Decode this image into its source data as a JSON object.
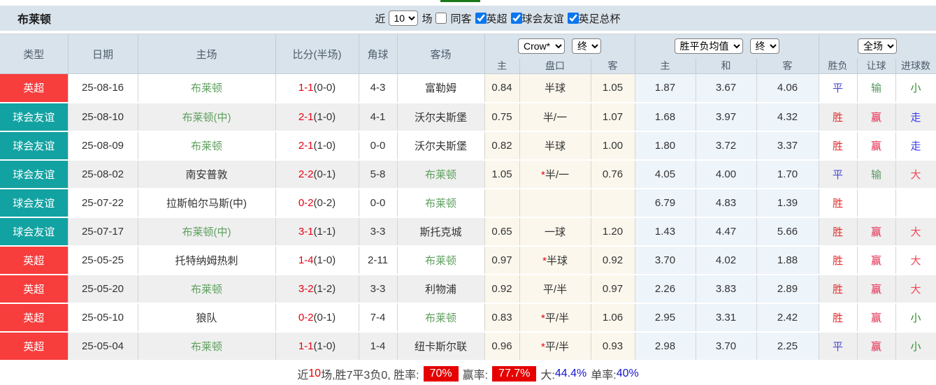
{
  "title": "布莱顿",
  "controls": {
    "near_label": "近",
    "games_count": "10",
    "games_label": "场",
    "same_away_label": "同客",
    "same_away_checked": false,
    "leagues": [
      {
        "label": "英超",
        "checked": true
      },
      {
        "label": "球会友谊",
        "checked": true
      },
      {
        "label": "英足总杯",
        "checked": true
      }
    ]
  },
  "header": {
    "cols": [
      "类型",
      "日期",
      "主场",
      "比分(半场)",
      "角球",
      "客场"
    ],
    "sub": [
      "主",
      "盘口",
      "客",
      "主",
      "和",
      "客",
      "胜负",
      "让球",
      "进球数"
    ],
    "selects": {
      "odds_source": "Crow*",
      "odds_time": "终",
      "avg_source": "胜平负均值",
      "avg_time": "终",
      "full_court": "全场"
    }
  },
  "rows": [
    {
      "league": "英超",
      "league_class": "lg-epl",
      "date": "25-08-16",
      "home": "布莱顿",
      "home_class": "team-self",
      "score": "1-1",
      "half": "(0-0)",
      "corner": "4-3",
      "away": "富勒姆",
      "away_class": "",
      "odds_home": "0.84",
      "line_star": "",
      "line": "半球",
      "odds_away": "1.05",
      "avg_home": "1.87",
      "avg_draw": "3.67",
      "avg_away": "4.06",
      "wdl": "平",
      "wdl_class": "c-draw",
      "handicap": "输",
      "handicap_class": "c-lose",
      "goals": "小",
      "goals_class": "c-small"
    },
    {
      "league": "球会友谊",
      "league_class": "lg-friendly",
      "date": "25-08-10",
      "home": "布莱顿(中)",
      "home_class": "team-self",
      "score": "2-1",
      "half": "(1-0)",
      "corner": "4-1",
      "away": "沃尔夫斯堡",
      "away_class": "",
      "odds_home": "0.75",
      "line_star": "",
      "line": "半/一",
      "odds_away": "1.07",
      "avg_home": "1.68",
      "avg_draw": "3.97",
      "avg_away": "4.32",
      "wdl": "胜",
      "wdl_class": "c-win",
      "handicap": "赢",
      "handicap_class": "c-winlet",
      "goals": "走",
      "goals_class": "c-walk"
    },
    {
      "league": "球会友谊",
      "league_class": "lg-friendly",
      "date": "25-08-09",
      "home": "布莱顿",
      "home_class": "team-self",
      "score": "2-1",
      "half": "(1-0)",
      "corner": "0-0",
      "away": "沃尔夫斯堡",
      "away_class": "",
      "odds_home": "0.82",
      "line_star": "",
      "line": "半球",
      "odds_away": "1.00",
      "avg_home": "1.80",
      "avg_draw": "3.72",
      "avg_away": "3.37",
      "wdl": "胜",
      "wdl_class": "c-win",
      "handicap": "赢",
      "handicap_class": "c-winlet",
      "goals": "走",
      "goals_class": "c-walk"
    },
    {
      "league": "球会友谊",
      "league_class": "lg-friendly",
      "date": "25-08-02",
      "home": "南安普敦",
      "home_class": "",
      "score": "2-2",
      "half": "(0-1)",
      "corner": "5-8",
      "away": "布莱顿",
      "away_class": "team-self",
      "odds_home": "1.05",
      "line_star": "*",
      "line": "半/一",
      "odds_away": "0.76",
      "avg_home": "4.05",
      "avg_draw": "4.00",
      "avg_away": "1.70",
      "wdl": "平",
      "wdl_class": "c-draw",
      "handicap": "输",
      "handicap_class": "c-lose",
      "goals": "大",
      "goals_class": "c-big"
    },
    {
      "league": "球会友谊",
      "league_class": "lg-friendly",
      "date": "25-07-22",
      "home": "拉斯帕尔马斯(中)",
      "home_class": "",
      "score": "0-2",
      "half": "(0-2)",
      "corner": "0-0",
      "away": "布莱顿",
      "away_class": "team-self",
      "odds_home": "",
      "line_star": "",
      "line": "",
      "odds_away": "",
      "avg_home": "6.79",
      "avg_draw": "4.83",
      "avg_away": "1.39",
      "wdl": "胜",
      "wdl_class": "c-win",
      "handicap": "",
      "handicap_class": "",
      "goals": "",
      "goals_class": ""
    },
    {
      "league": "球会友谊",
      "league_class": "lg-friendly",
      "date": "25-07-17",
      "home": "布莱顿(中)",
      "home_class": "team-self",
      "score": "3-1",
      "half": "(1-1)",
      "corner": "3-3",
      "away": "斯托克城",
      "away_class": "",
      "odds_home": "0.65",
      "line_star": "",
      "line": "一球",
      "odds_away": "1.20",
      "avg_home": "1.43",
      "avg_draw": "4.47",
      "avg_away": "5.66",
      "wdl": "胜",
      "wdl_class": "c-win",
      "handicap": "赢",
      "handicap_class": "c-winlet",
      "goals": "大",
      "goals_class": "c-big"
    },
    {
      "league": "英超",
      "league_class": "lg-epl",
      "date": "25-05-25",
      "home": "托特纳姆热刺",
      "home_class": "",
      "score": "1-4",
      "half": "(1-0)",
      "corner": "2-11",
      "away": "布莱顿",
      "away_class": "team-self",
      "odds_home": "0.97",
      "line_star": "*",
      "line": "半球",
      "odds_away": "0.92",
      "avg_home": "3.70",
      "avg_draw": "4.02",
      "avg_away": "1.88",
      "wdl": "胜",
      "wdl_class": "c-win",
      "handicap": "赢",
      "handicap_class": "c-winlet",
      "goals": "大",
      "goals_class": "c-big"
    },
    {
      "league": "英超",
      "league_class": "lg-epl",
      "date": "25-05-20",
      "home": "布莱顿",
      "home_class": "team-self",
      "score": "3-2",
      "half": "(1-2)",
      "corner": "3-3",
      "away": "利物浦",
      "away_class": "",
      "odds_home": "0.92",
      "line_star": "",
      "line": "平/半",
      "odds_away": "0.97",
      "avg_home": "2.26",
      "avg_draw": "3.83",
      "avg_away": "2.89",
      "wdl": "胜",
      "wdl_class": "c-win",
      "handicap": "赢",
      "handicap_class": "c-winlet",
      "goals": "大",
      "goals_class": "c-big"
    },
    {
      "league": "英超",
      "league_class": "lg-epl",
      "date": "25-05-10",
      "home": "狼队",
      "home_class": "",
      "score": "0-2",
      "half": "(0-1)",
      "corner": "7-4",
      "away": "布莱顿",
      "away_class": "team-self",
      "odds_home": "0.83",
      "line_star": "*",
      "line": "平/半",
      "odds_away": "1.06",
      "avg_home": "2.95",
      "avg_draw": "3.31",
      "avg_away": "2.42",
      "wdl": "胜",
      "wdl_class": "c-win",
      "handicap": "赢",
      "handicap_class": "c-winlet",
      "goals": "小",
      "goals_class": "c-small"
    },
    {
      "league": "英超",
      "league_class": "lg-epl",
      "date": "25-05-04",
      "home": "布莱顿",
      "home_class": "team-self",
      "score": "1-1",
      "half": "(1-0)",
      "corner": "1-4",
      "away": "纽卡斯尔联",
      "away_class": "",
      "odds_home": "0.96",
      "line_star": "*",
      "line": "平/半",
      "odds_away": "0.93",
      "avg_home": "2.98",
      "avg_draw": "3.70",
      "avg_away": "2.25",
      "wdl": "平",
      "wdl_class": "c-draw",
      "handicap": "赢",
      "handicap_class": "c-winlet",
      "goals": "小",
      "goals_class": "c-small"
    }
  ],
  "footer": {
    "part1": "近",
    "count": "10",
    "part2": "场,胜7平3负0, 胜率:",
    "win_rate": "70%",
    "part3": "赢率:",
    "profit_rate": "77.7%",
    "part4": "大:",
    "big_rate": "44.4%",
    "part5": "单率:",
    "single_rate": "40%"
  },
  "colors": {
    "epl_red": "#f83d3d",
    "friendly_teal": "#12a2a2",
    "score_red": "#e60012",
    "team_green": "#5ea05e",
    "win_red": "#e03030",
    "draw_blue": "#4a4ad0",
    "lose_green": "#55975f",
    "walk_blue": "#3a3af2",
    "big_red": "#ef4858",
    "small_green": "#2f8f2f",
    "rate_badge_bg": "#e60000",
    "rate_blue": "#1515d0",
    "header_bg": "#d9e3ec",
    "odds_col_bg": "#fbf7ec",
    "avg_col_bg": "#edf4fa",
    "top_line_green": "#1a7a1a"
  }
}
